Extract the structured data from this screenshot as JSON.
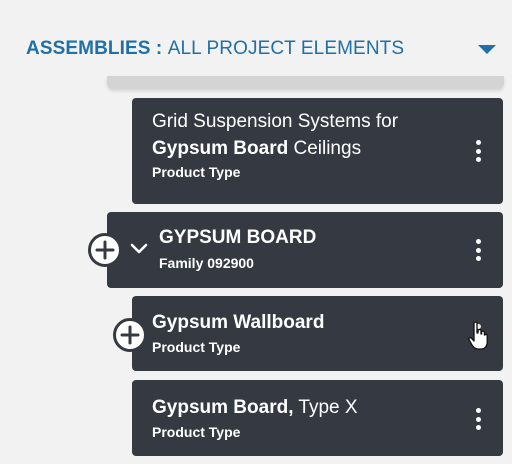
{
  "header": {
    "prefix": "ASSEMBLIES",
    "separator": " : ",
    "scope": "ALL PROJECT ELEMENTS",
    "dropdown_icon": "caret-down-icon"
  },
  "cards": [
    {
      "title_line1": "Grid Suspension Systems for",
      "title_bold": "Gypsum Board",
      "title_rest": " Ceilings",
      "subtitle": "Product Type",
      "menu_icon": "kebab-menu-icon"
    },
    {
      "title": "GYPSUM BOARD",
      "subtitle": "Family 092900",
      "add_icon": "plus-circle-icon",
      "expand_icon": "chevron-down-icon",
      "menu_icon": "kebab-menu-icon"
    },
    {
      "title": "Gypsum Wallboard",
      "subtitle": "Product Type",
      "add_icon": "plus-circle-icon",
      "menu_icon": "kebab-menu-icon"
    },
    {
      "title_bold": "Gypsum Board,",
      "title_rest": " Type X",
      "subtitle": "Product Type",
      "menu_icon": "kebab-menu-icon"
    }
  ],
  "colors": {
    "accent": "#1f6fa8",
    "card_bg": "#353a42",
    "page_bg": "#f2f2f2",
    "card_text": "#ffffff"
  }
}
